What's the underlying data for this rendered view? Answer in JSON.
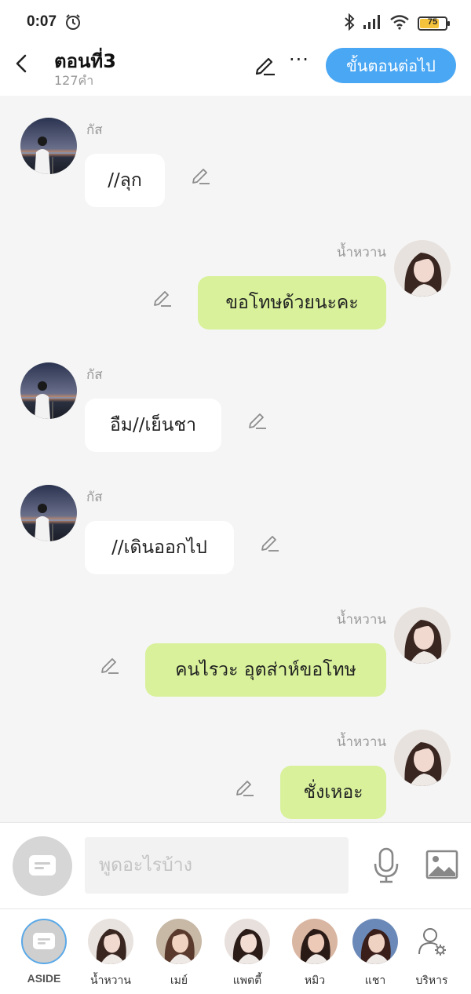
{
  "status": {
    "time": "0:07",
    "battery": "75",
    "battery_level": 0.75
  },
  "header": {
    "title": "ตอนที่3",
    "word_count": "127คำ",
    "next_label": "ขั้นตอนต่อไป",
    "more_label": "···"
  },
  "messages": [
    {
      "sender": "กัส",
      "text": "//ลุก",
      "side": "left",
      "avatar": "gus"
    },
    {
      "sender": "น้ำหวาน",
      "text": "ขอโทษด้วยนะคะ",
      "side": "right",
      "avatar": "namwan"
    },
    {
      "sender": "กัส",
      "text": "อืม//เย็นชา",
      "side": "left",
      "avatar": "gus"
    },
    {
      "sender": "กัส",
      "text": "//เดินออกไป",
      "side": "left",
      "avatar": "gus"
    },
    {
      "sender": "น้ำหวาน",
      "text": "คนไรวะ อุตส่าห์ขอโทษ",
      "side": "right",
      "avatar": "namwan"
    },
    {
      "sender": "น้ำหวาน",
      "text": "ชั่งเหอะ",
      "side": "right",
      "avatar": "namwan"
    }
  ],
  "input": {
    "placeholder": "พูดอะไรบ้าง"
  },
  "characters": [
    {
      "label": "ASIDE",
      "kind": "aside"
    },
    {
      "label": "น้ำหวาน",
      "kind": "photo"
    },
    {
      "label": "เมย์",
      "kind": "photo"
    },
    {
      "label": "แพตตี้",
      "kind": "photo"
    },
    {
      "label": "หมิว",
      "kind": "photo"
    },
    {
      "label": "แชา",
      "kind": "photo"
    },
    {
      "label": "บริหาร",
      "kind": "admin"
    }
  ],
  "colors": {
    "accent": "#4aa7f3",
    "right_bubble": "#d8f19a",
    "left_bubble": "#ffffff"
  },
  "icons": [
    "back-arrow-icon",
    "pencil-icon",
    "more-icon",
    "chat-bubble-icon",
    "mic-icon",
    "image-icon",
    "admin-gear-icon",
    "alarm-icon",
    "bluetooth-icon",
    "signal-icon",
    "wifi-icon",
    "battery-icon"
  ]
}
